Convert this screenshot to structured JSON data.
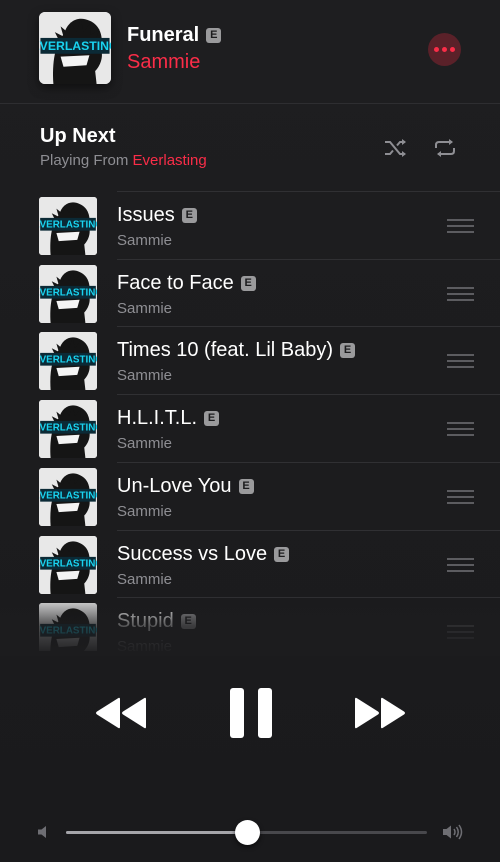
{
  "now_playing": {
    "title": "Funeral",
    "explicit_badge": "E",
    "artist": "Sammie",
    "more_icon": "more-icon"
  },
  "up_next": {
    "title": "Up Next",
    "playing_from_label": "Playing From",
    "source": "Everlasting",
    "shuffle_icon": "shuffle-icon",
    "repeat_icon": "repeat-icon"
  },
  "queue": [
    {
      "title": "Issues",
      "artist": "Sammie",
      "badge": "E"
    },
    {
      "title": "Face to Face",
      "artist": "Sammie",
      "badge": "E"
    },
    {
      "title": "Times 10 (feat. Lil Baby)",
      "artist": "Sammie",
      "badge": "E"
    },
    {
      "title": "H.L.I.T.L.",
      "artist": "Sammie",
      "badge": "E"
    },
    {
      "title": "Un-Love You",
      "artist": "Sammie",
      "badge": "E"
    },
    {
      "title": "Success vs Love",
      "artist": "Sammie",
      "badge": "E"
    },
    {
      "title": "Stupid",
      "artist": "Sammie",
      "badge": "E"
    }
  ],
  "album_art_text": "EVERLASTING",
  "controls": {
    "rewind_icon": "rewind-icon",
    "pause_icon": "pause-icon",
    "forward_icon": "fast-forward-icon"
  },
  "volume": {
    "level": 0.5,
    "low_icon": "volume-low-icon",
    "high_icon": "volume-high-icon"
  },
  "colors": {
    "accent": "#fa2d48",
    "background": "#1c1c1e"
  }
}
